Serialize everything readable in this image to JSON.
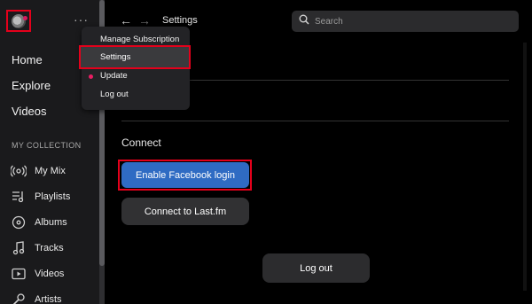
{
  "colors": {
    "highlight_outline": "#e4001b",
    "primary_button": "#2f6bc3",
    "update_dot": "#e91e63",
    "sidebar_bg": "#1a1a1c"
  },
  "header": {
    "more_label": "···",
    "back_icon": "arrow-left-icon",
    "forward_icon": "arrow-right-icon",
    "title": "Settings"
  },
  "search": {
    "placeholder": "Search",
    "value": ""
  },
  "menu": {
    "items": [
      {
        "label": "Manage Subscription"
      },
      {
        "label": "Settings",
        "selected": true
      },
      {
        "label": "Update",
        "badge": "dot"
      },
      {
        "label": "Log out"
      }
    ]
  },
  "sidebar": {
    "main_nav": [
      {
        "label": "Home"
      },
      {
        "label": "Explore"
      },
      {
        "label": "Videos"
      }
    ],
    "section_title": "MY COLLECTION",
    "collection": [
      {
        "label": "My Mix",
        "icon": "radio-waves-icon"
      },
      {
        "label": "Playlists",
        "icon": "playlist-icon"
      },
      {
        "label": "Albums",
        "icon": "album-disc-icon"
      },
      {
        "label": "Tracks",
        "icon": "music-note-icon"
      },
      {
        "label": "Videos",
        "icon": "video-play-icon"
      },
      {
        "label": "Artists",
        "icon": "microphone-icon"
      }
    ]
  },
  "content": {
    "section_label": "Connect",
    "facebook_button": "Enable Facebook login",
    "lastfm_button": "Connect to Last.fm",
    "logout_button": "Log out"
  }
}
